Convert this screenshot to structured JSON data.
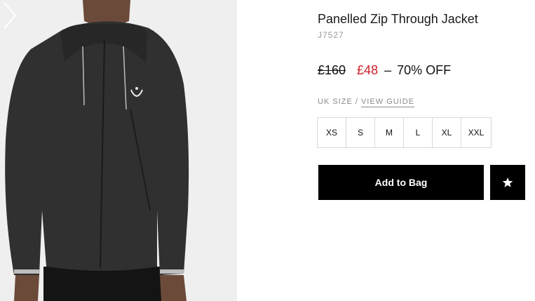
{
  "product": {
    "title": "Panelled Zip Through Jacket",
    "sku": "J7527",
    "price_was": "£160",
    "price_now": "£48",
    "price_separator": "–",
    "discount": "70% OFF"
  },
  "size_selector": {
    "label": "UK SIZE / ",
    "guide_link": "VIEW GUIDE",
    "sizes": [
      "XS",
      "S",
      "M",
      "L",
      "XL",
      "XXL"
    ]
  },
  "actions": {
    "add_to_bag": "Add to Bag",
    "wishlist_icon": "star-icon"
  },
  "colors": {
    "sale_price": "#d0202a",
    "button_bg": "#000000",
    "jacket": "#2f302f",
    "gallery_bg": "#efefef"
  },
  "gallery": {
    "next_icon": "chevron-right-icon"
  }
}
